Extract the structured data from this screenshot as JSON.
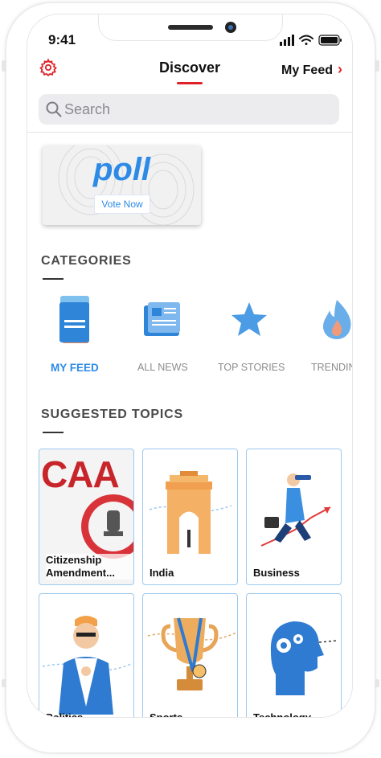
{
  "status": {
    "time": "9:41"
  },
  "header": {
    "title": "Discover",
    "my_feed_label": "My Feed",
    "my_feed_chevron": "›"
  },
  "search": {
    "placeholder": "Search"
  },
  "poll_card": {
    "word": "poll",
    "button_label": "Vote Now"
  },
  "categories": {
    "title": "CATEGORIES",
    "items": [
      {
        "label": "MY FEED",
        "icon": "my-feed-icon",
        "active": true
      },
      {
        "label": "ALL NEWS",
        "icon": "newspaper-icon",
        "active": false
      },
      {
        "label": "TOP STORIES",
        "icon": "star-icon",
        "active": false
      },
      {
        "label": "TRENDING",
        "icon": "flame-icon",
        "active": false
      }
    ]
  },
  "suggested": {
    "title": "SUGGESTED TOPICS",
    "caa_banner_text": "CAA",
    "topics": [
      {
        "label": "Citizenship Amendment...",
        "icon": "caa-emblem-icon"
      },
      {
        "label": "India",
        "icon": "india-gate-icon"
      },
      {
        "label": "Business",
        "icon": "businessman-icon"
      },
      {
        "label": "Politics",
        "icon": "politician-icon"
      },
      {
        "label": "Sports",
        "icon": "trophy-icon"
      },
      {
        "label": "Technology",
        "icon": "tech-head-icon"
      }
    ]
  },
  "colors": {
    "accent": "#e02127",
    "link_blue": "#2d8ae6",
    "active_category": "#2d8ae6"
  }
}
